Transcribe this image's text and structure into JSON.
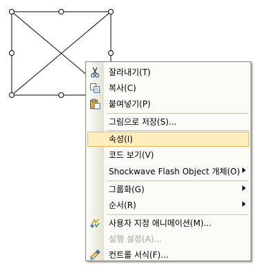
{
  "context_menu": {
    "items": [
      {
        "label": "잘라내기(T)",
        "icon": "scissors-icon"
      },
      {
        "label": "복사(C)",
        "icon": "copy-icon"
      },
      {
        "label": "붙여넣기(P)",
        "icon": "paste-icon"
      },
      {
        "label": "그림으로 저장(S)..."
      },
      {
        "label": "속성(I)"
      },
      {
        "label": "코드 보기(V)"
      },
      {
        "label": "Shockwave Flash Object 개체(O)"
      },
      {
        "label": "그룹화(G)"
      },
      {
        "label": "순서(R)"
      },
      {
        "label": "사용자 지정 애니메이션(M)...",
        "icon": "custom-animation-icon"
      },
      {
        "label": "실행 설정(A)..."
      },
      {
        "label": "컨트롤 서식(F)...",
        "icon": "format-control-icon"
      }
    ]
  },
  "colors": {
    "highlight_bg": "#ffeebb",
    "highlight_border": "#e7b557",
    "disabled_text": "#a6a395"
  }
}
